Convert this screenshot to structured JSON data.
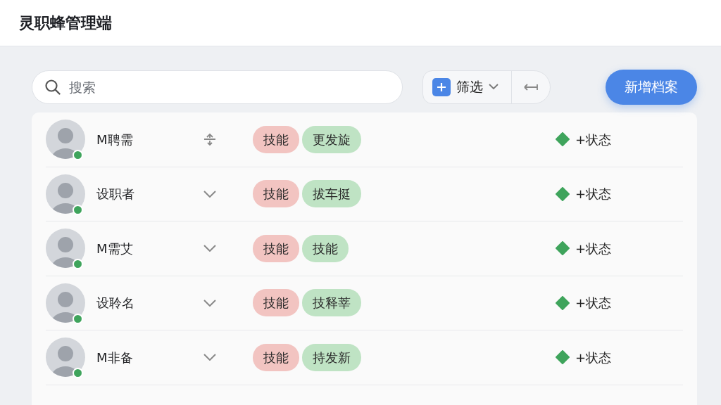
{
  "app": {
    "title": "灵职蜂管理端"
  },
  "toolbar": {
    "search_placeholder": "搜索",
    "filter_label": "筛选",
    "add_button": "新增档案"
  },
  "rows": [
    {
      "name": "M聘需",
      "online": true,
      "kind": "sort",
      "tags": [
        {
          "label": "技能",
          "color": "#f2c4c1"
        },
        {
          "label": "更发旋",
          "color": "#bfe3c4"
        }
      ],
      "status": "+状态"
    },
    {
      "name": "设职者",
      "online": true,
      "kind": "chevron",
      "tags": [
        {
          "label": "技能",
          "color": "#f2c4c1"
        },
        {
          "label": "拔车挺",
          "color": "#bfe3c4"
        }
      ],
      "status": "+状态"
    },
    {
      "name": "M需艾",
      "online": true,
      "kind": "chevron",
      "tags": [
        {
          "label": "技能",
          "color": "#f2c4c1"
        },
        {
          "label": "技能",
          "color": "#bfe3c4"
        }
      ],
      "status": "+状态"
    },
    {
      "name": "设聆名",
      "online": true,
      "kind": "chevron",
      "tags": [
        {
          "label": "技能",
          "color": "#f2c4c1"
        },
        {
          "label": "技释莘",
          "color": "#bfe3c4"
        }
      ],
      "status": "+状态"
    },
    {
      "name": "M非备",
      "online": true,
      "kind": "chevron",
      "tags": [
        {
          "label": "技能",
          "color": "#f2c4c1"
        },
        {
          "label": "持发新",
          "color": "#bfe3c4"
        }
      ],
      "status": "+状态"
    }
  ]
}
